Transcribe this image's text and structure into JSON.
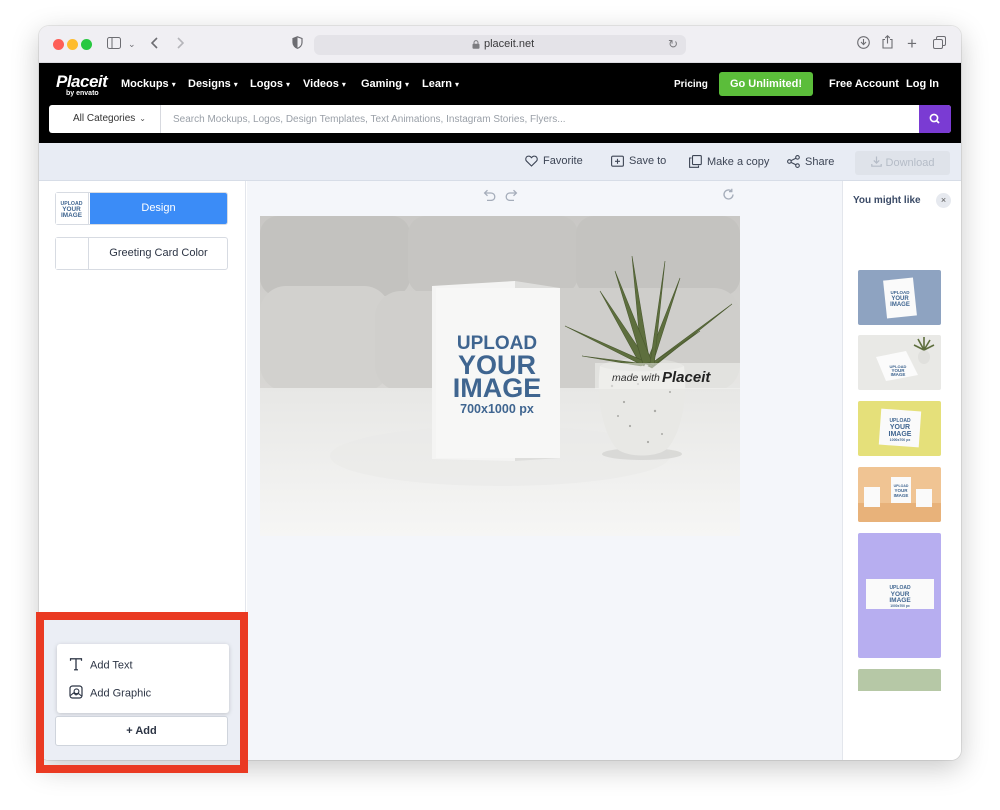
{
  "browser": {
    "url": "placeit.net"
  },
  "nav": {
    "logo": "Placeit",
    "logo_sub": "by envato",
    "links": [
      {
        "label": "Mockups"
      },
      {
        "label": "Designs"
      },
      {
        "label": "Logos"
      },
      {
        "label": "Videos"
      },
      {
        "label": "Gaming"
      },
      {
        "label": "Learn"
      }
    ],
    "pricing": "Pricing",
    "go_unlimited": "Go Unlimited!",
    "free_account": "Free Account",
    "log_in": "Log In"
  },
  "search": {
    "category": "All Categories",
    "placeholder": "Search Mockups, Logos, Design Templates, Text Animations, Instagram Stories, Flyers..."
  },
  "actions": {
    "favorite": "Favorite",
    "save_to": "Save to",
    "make_copy": "Make a copy",
    "share": "Share",
    "download": "Download"
  },
  "left_panel": {
    "options": [
      {
        "label": "Design",
        "thumb_text": [
          "UPLOAD",
          "YOUR",
          "IMAGE"
        ]
      },
      {
        "label": "Greeting Card Color"
      }
    ],
    "popup": {
      "add_text": "Add Text",
      "add_graphic": "Add Graphic"
    },
    "add_button": "+ Add"
  },
  "canvas": {
    "card_text": [
      "UPLOAD",
      "YOUR",
      "IMAGE"
    ],
    "card_size": "700x1000 px",
    "watermark_prefix": "made with",
    "watermark_brand": "Placeit"
  },
  "right_panel": {
    "title": "You might like",
    "close": "×",
    "thumbs": [
      {
        "bg": "#8ea3c1",
        "text": [
          "UPLOAD",
          "YOUR",
          "IMAGE"
        ]
      },
      {
        "bg": "#e9e9e6",
        "text": [
          "UPLOAD",
          "YOUR",
          "IMAGE"
        ]
      },
      {
        "bg": "#e5e07a",
        "text": [
          "UPLOAD",
          "YOUR",
          "IMAGE"
        ],
        "sub": "1000x700 px"
      },
      {
        "bg": "#f0c493",
        "text": [
          "UPLOAD",
          "YOUR",
          "IMAGE"
        ]
      },
      {
        "bg": "#b7aef0",
        "text": [
          "UPLOAD",
          "YOUR",
          "IMAGE"
        ],
        "sub": "1000x700 px"
      },
      {
        "bg": "#b6c8a6"
      }
    ]
  },
  "colors": {
    "accent_blue": "#3b8cf7",
    "unlimited_green": "#5bbd3a",
    "search_purple": "#7a3bd3",
    "highlight_red": "#ea3a22",
    "card_text_blue": "#3f6590"
  }
}
